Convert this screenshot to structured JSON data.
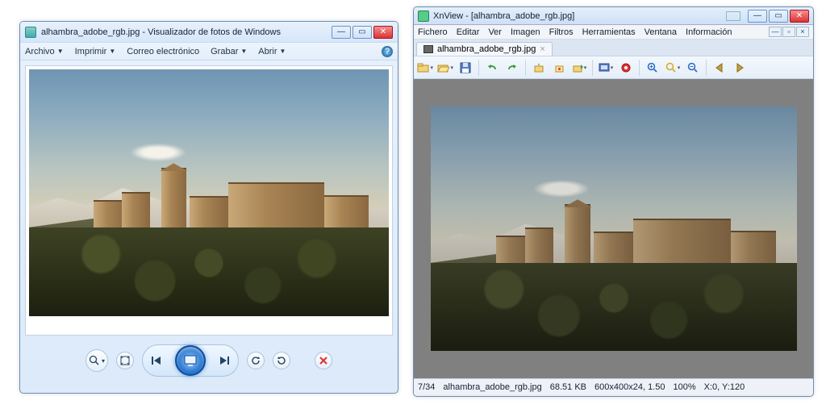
{
  "wpv": {
    "title": "alhambra_adobe_rgb.jpg - Visualizador de fotos de Windows",
    "menu": {
      "archivo": "Archivo",
      "imprimir": "Imprimir",
      "correo": "Correo electrónico",
      "grabar": "Grabar",
      "abrir": "Abrir"
    },
    "help_tooltip": "?"
  },
  "xn": {
    "title": "XnView - [alhambra_adobe_rgb.jpg]",
    "menu": {
      "fichero": "Fichero",
      "editar": "Editar",
      "ver": "Ver",
      "imagen": "Imagen",
      "filtros": "Filtros",
      "herramientas": "Herramientas",
      "ventana": "Ventana",
      "informacion": "Información"
    },
    "tab": {
      "label": "alhambra_adobe_rgb.jpg"
    },
    "status": {
      "index": "7/34",
      "filename": "alhambra_adobe_rgb.jpg",
      "size": "68.51 KB",
      "dims": "600x400x24, 1.50",
      "zoom": "100%",
      "coords": "X:0, Y:120"
    }
  }
}
